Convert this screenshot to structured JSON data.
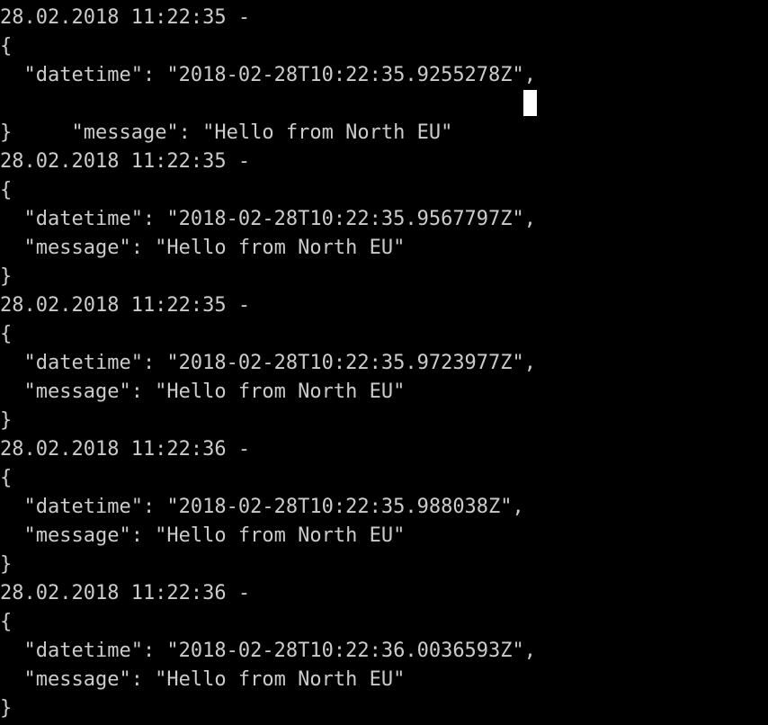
{
  "console": {
    "entries": [
      {
        "header": "28.02.2018 11:22:35 -",
        "open_brace": "{",
        "datetime_line": "  \"datetime\": \"2018-02-28T10:22:35.9255278Z\",",
        "message_line": "  \"message\": \"Hello from North EU\"",
        "close_brace": "}"
      },
      {
        "header": "28.02.2018 11:22:35 -",
        "open_brace": "{",
        "datetime_line": "  \"datetime\": \"2018-02-28T10:22:35.9567797Z\",",
        "message_line": "  \"message\": \"Hello from North EU\"",
        "close_brace": "}"
      },
      {
        "header": "28.02.2018 11:22:35 -",
        "open_brace": "{",
        "datetime_line": "  \"datetime\": \"2018-02-28T10:22:35.9723977Z\",",
        "message_line": "  \"message\": \"Hello from North EU\"",
        "close_brace": "}"
      },
      {
        "header": "28.02.2018 11:22:36 -",
        "open_brace": "{",
        "datetime_line": "  \"datetime\": \"2018-02-28T10:22:35.988038Z\",",
        "message_line": "  \"message\": \"Hello from North EU\"",
        "close_brace": "}"
      },
      {
        "header": "28.02.2018 11:22:36 -",
        "open_brace": "{",
        "datetime_line": "  \"datetime\": \"2018-02-28T10:22:36.0036593Z\",",
        "message_line": "  \"message\": \"Hello from North EU\"",
        "close_brace": "}"
      }
    ]
  },
  "colors": {
    "background": "#000000",
    "text": "#CCCCCC",
    "cursor": "#FFFFFF"
  }
}
